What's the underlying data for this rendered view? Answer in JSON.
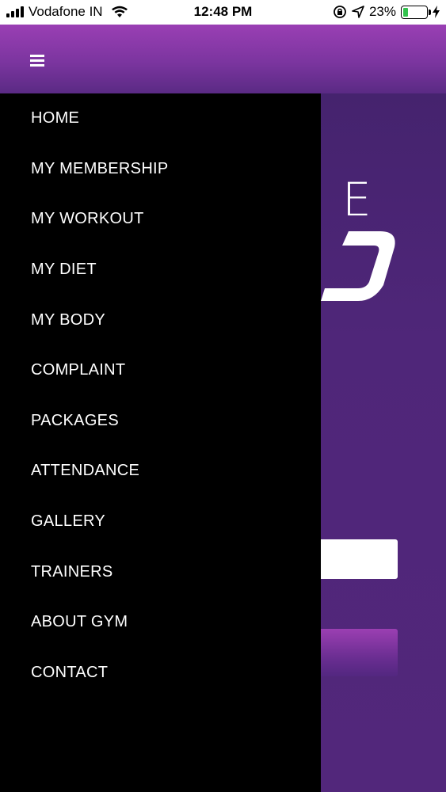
{
  "status_bar": {
    "carrier": "Vodafone IN",
    "time": "12:48 PM",
    "battery_percent": "23%",
    "battery_level": 0.23,
    "icons": [
      "signal-bars-icon",
      "wifi-icon",
      "rotation-lock-icon",
      "location-arrow-icon",
      "battery-icon",
      "charging-bolt-icon"
    ]
  },
  "header": {
    "menu_icon": "hamburger-menu-icon"
  },
  "background": {
    "logo_letter": "E"
  },
  "drawer": {
    "items": [
      {
        "label": "HOME"
      },
      {
        "label": "MY MEMBERSHIP"
      },
      {
        "label": "MY WORKOUT"
      },
      {
        "label": "MY DIET"
      },
      {
        "label": "MY BODY"
      },
      {
        "label": "COMPLAINT"
      },
      {
        "label": "PACKAGES"
      },
      {
        "label": "ATTENDANCE"
      },
      {
        "label": "GALLERY"
      },
      {
        "label": "TRAINERS"
      },
      {
        "label": "ABOUT GYM"
      },
      {
        "label": "CONTACT"
      }
    ]
  },
  "colors": {
    "header_top": "#9a3fb4",
    "header_bottom": "#5a2a84",
    "content_bg": "#4f2679",
    "drawer_bg": "#000000",
    "drawer_text": "#ffffff",
    "battery_fill": "#33c24d"
  }
}
